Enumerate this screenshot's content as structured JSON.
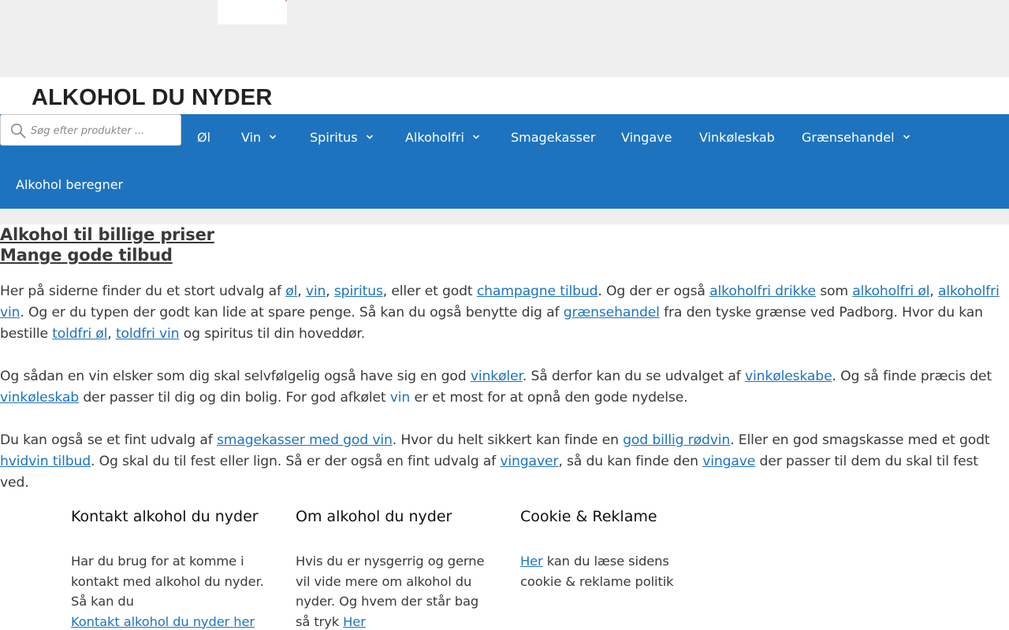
{
  "site": {
    "title": "ALKOHOL DU NYDER"
  },
  "search": {
    "placeholder": "Søg efter produkter ..."
  },
  "nav": {
    "items": [
      {
        "label": "Øl",
        "has_dropdown": false
      },
      {
        "label": "Vin",
        "has_dropdown": true
      },
      {
        "label": "Spiritus",
        "has_dropdown": true
      },
      {
        "label": "Alkoholfri",
        "has_dropdown": true
      },
      {
        "label": "Smagekasser",
        "has_dropdown": false
      },
      {
        "label": "Vingave",
        "has_dropdown": false
      },
      {
        "label": "Vinkøleskab",
        "has_dropdown": false
      },
      {
        "label": "Grænsehandel",
        "has_dropdown": true
      },
      {
        "label": "Alkohol beregner",
        "has_dropdown": false
      }
    ]
  },
  "headlines": {
    "line1": "Alkohol til billige priser",
    "line2": "Mange gode tilbud"
  },
  "content": {
    "p1": {
      "t1": "Her på siderne finder du et stort udvalg af ",
      "l_ol": "øl",
      "s1": ", ",
      "l_vin": "vin",
      "s2": ", ",
      "l_spiritus": "spiritus",
      "t2": ", eller et godt ",
      "l_champagne": "champagne tilbud",
      "t3": ". Og der er også ",
      "l_alkoholfri_drikke": "alkoholfri drikke",
      "t4": " som ",
      "l_alkoholfri_ol": "alkoholfri øl",
      "s3": ", ",
      "l_alkoholfri_vin": "alkoholfri vin",
      "t5": ". Og er du typen der godt kan lide at spare penge. Så kan du også benytte dig af ",
      "l_graensehandel": "grænsehandel",
      "t6": " fra den tyske grænse ved Padborg. Hvor du kan bestille ",
      "l_toldfri_ol": "toldfri øl",
      "s4": ", ",
      "l_toldfri_vin": "toldfri vin",
      "t7": " og spiritus til din hoveddør."
    },
    "p2": {
      "t1": "Og sådan en vin elsker som dig skal selvfølgelig også have sig en god ",
      "l_vinkoler": "vinkøler",
      "t2": ". Så derfor kan du se udvalget af ",
      "l_vinkoleskabe": "vinkøleskabe",
      "t3": ". Og så finde præcis det ",
      "l_vinkoleskab": "vinkøleskab",
      "t4": " der passer til dig og din bolig. For god afkølet ",
      "l_vin": "vin",
      "t5": " er et most for at opnå den gode nydelse."
    },
    "p3": {
      "t1": "Du kan også se et fint udvalg af ",
      "l_smagekasser": "smagekasser med god vin",
      "t2": ". Hvor du helt sikkert kan finde en ",
      "l_rodvin": "god billig rødvin",
      "t3": ". Eller en god smagskasse med et godt ",
      "l_hvidvin": "hvidvin tilbud",
      "t4": ". Og skal du til fest eller lign. Så er der også en fint udvalg af ",
      "l_vingaver": "vingaver",
      "t5": ", så du kan finde den ",
      "l_vingave": "vingave",
      "t6": " der passer til dem du skal til fest ved."
    }
  },
  "footer": {
    "contact": {
      "heading": "Kontakt alkohol du nyder",
      "text": "Har du brug for at komme i kontakt med alkohol du nyder. Så kan du",
      "link": "Kontakt alkohol du nyder her"
    },
    "about": {
      "heading": "Om alkohol du nyder",
      "text": "Hvis du er nysgerrig og gerne vil vide mere om alkohol du nyder. Og hvem der står bag så tryk ",
      "link": "Her"
    },
    "cookie": {
      "heading": "Cookie & Reklame",
      "link": "Her",
      "text": " kan du læse sidens cookie & reklame politik"
    }
  },
  "colors": {
    "nav_bg": "#1e73be",
    "link": "#1e73be",
    "text": "#3a3a3a",
    "band": "#efefef"
  }
}
